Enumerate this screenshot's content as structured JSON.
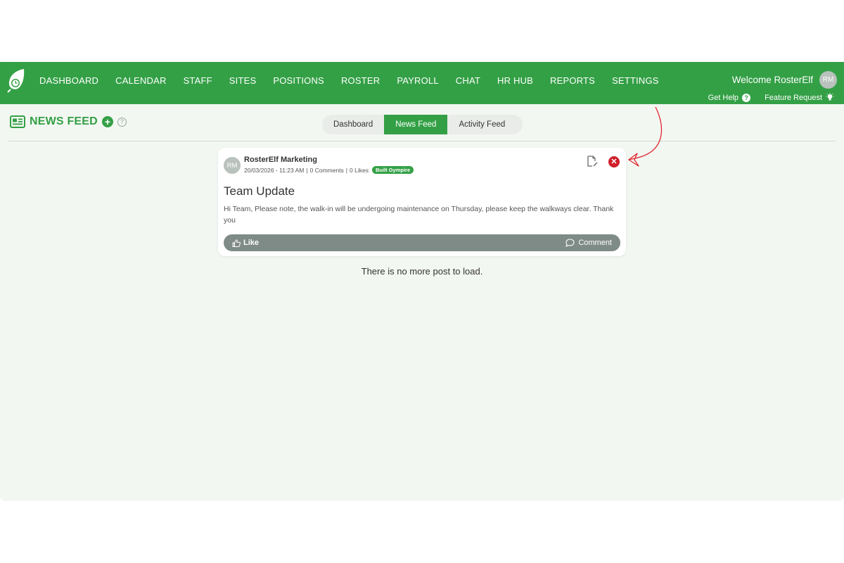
{
  "brand": {
    "accent": "#34a046",
    "danger": "#d01f2a"
  },
  "nav": {
    "items": [
      "DASHBOARD",
      "CALENDAR",
      "STAFF",
      "SITES",
      "POSITIONS",
      "ROSTER",
      "PAYROLL",
      "CHAT",
      "HR HUB",
      "REPORTS",
      "SETTINGS"
    ]
  },
  "user": {
    "welcome": "Welcome RosterElf",
    "initials": "RM"
  },
  "help": {
    "get_help": "Get Help",
    "get_help_icon": "?",
    "feature_request": "Feature Request"
  },
  "header": {
    "title": "NEWS FEED",
    "add_icon": "+",
    "info_icon": "?"
  },
  "tabs": [
    {
      "label": "Dashboard",
      "active": false
    },
    {
      "label": "News Feed",
      "active": true
    },
    {
      "label": "Activity Feed",
      "active": false
    }
  ],
  "post": {
    "initials": "RM",
    "author": "RosterElf Marketing",
    "datetime": "20/03/2026 - 11:23 AM",
    "sep": "|",
    "comments": "0 Comments",
    "likes": "0 Likes",
    "site": "Built Gympire",
    "title": "Team Update",
    "body": "Hi Team, Please note, the walk-in will be undergoing maintenance on Thursday, please keep the walkways clear. Thank you",
    "like_label": "Like",
    "comment_label": "Comment",
    "delete_glyph": "✕"
  },
  "end_message": "There is no more post to load."
}
